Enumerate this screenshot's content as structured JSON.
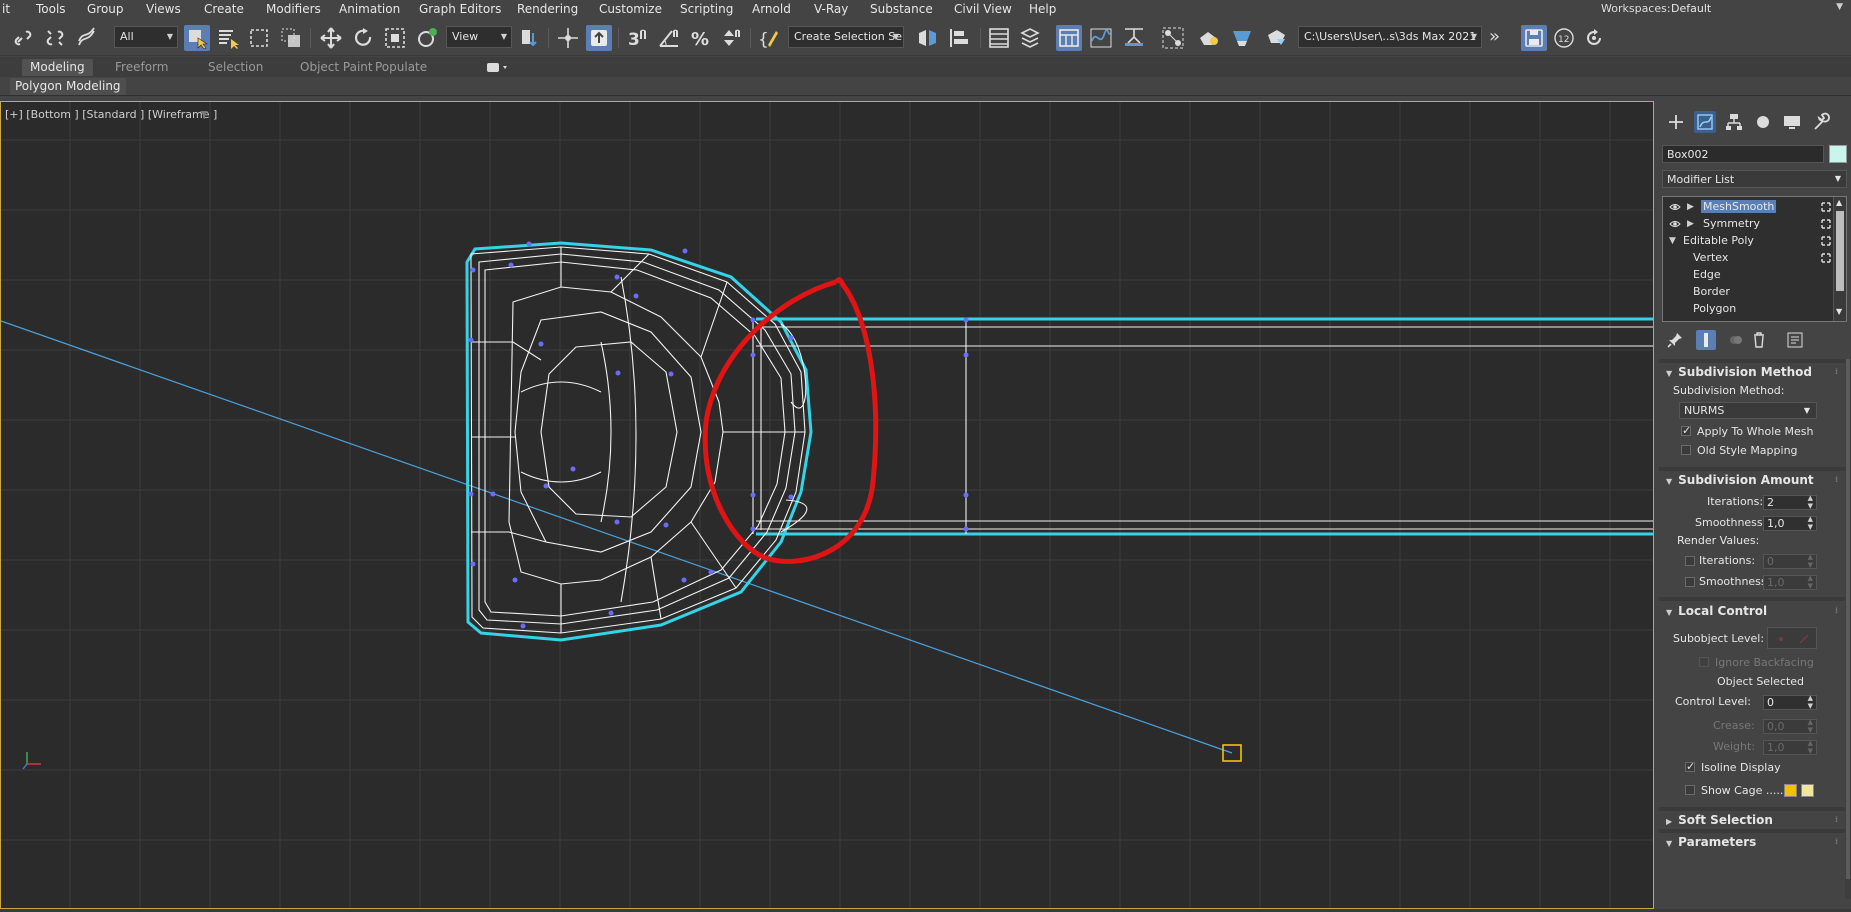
{
  "menu": {
    "items": [
      "it",
      "Tools",
      "Group",
      "Views",
      "Create",
      "Modifiers",
      "Animation",
      "Graph Editors",
      "Rendering",
      "Customize",
      "Scripting",
      "Arnold",
      "V-Ray",
      "Substance",
      "Civil View",
      "Help"
    ],
    "workspaces_label": "Workspaces:",
    "workspaces_value": "Default"
  },
  "toolbar": {
    "selection_filter": "All",
    "reference_coord": "View",
    "selection_set": "Create Selection Se",
    "project_path": "C:\\Users\\User\\..s\\3ds Max 2021",
    "badge_count": "12",
    "overflow": "»"
  },
  "ribbon": {
    "tabs": [
      "Modeling",
      "Freeform",
      "Selection",
      "Object Paint",
      "Populate"
    ],
    "active_tab": "Modeling",
    "panel_label": "Polygon Modeling"
  },
  "viewport": {
    "label": "[+] [Bottom ] [Standard ] [Wireframe ]"
  },
  "command_panel": {
    "object_name": "Box002",
    "object_color": "#c8f5ec",
    "modifier_list_label": "Modifier List",
    "stack": [
      {
        "label": "MeshSmooth",
        "selected": true
      },
      {
        "label": "Symmetry",
        "selected": false
      },
      {
        "label": "Editable Poly",
        "selected": false
      },
      {
        "label": "Vertex",
        "selected": false
      },
      {
        "label": "Edge",
        "selected": false
      },
      {
        "label": "Border",
        "selected": false
      },
      {
        "label": "Polygon",
        "selected": false
      }
    ],
    "subdivision_method": {
      "title": "Subdivision Method",
      "method_label": "Subdivision Method:",
      "method_value": "NURMS",
      "apply_whole_mesh": "Apply To Whole Mesh",
      "apply_whole_mesh_checked": true,
      "old_style_mapping": "Old Style Mapping",
      "old_style_mapping_checked": false
    },
    "subdivision_amount": {
      "title": "Subdivision Amount",
      "iterations_label": "Iterations:",
      "iterations_value": "2",
      "smoothness_label": "Smoothness:",
      "smoothness_value": "1,0",
      "render_values_label": "Render Values:",
      "render_iterations_label": "Iterations:",
      "render_iterations_value": "0",
      "render_smoothness_label": "Smoothness:",
      "render_smoothness_value": "1,0"
    },
    "local_control": {
      "title": "Local Control",
      "subobject_label": "Subobject Level:",
      "ignore_backfacing": "Ignore Backfacing",
      "object_selected": "Object Selected",
      "control_level_label": "Control Level:",
      "control_level_value": "0",
      "crease_label": "Crease:",
      "crease_value": "0,0",
      "weight_label": "Weight:",
      "weight_value": "1,0",
      "isoline_display": "Isoline Display",
      "isoline_checked": true,
      "show_cage": "Show Cage ......",
      "show_cage_checked": false,
      "cage_color_1": "#f2c200",
      "cage_color_2": "#f0e6a0"
    },
    "soft_selection": {
      "title": "Soft Selection"
    },
    "parameters": {
      "title": "Parameters"
    }
  },
  "colors": {
    "accent": "#5b7fb5",
    "viewport_bg": "#2b2b2b",
    "viewport_border": "#c9a846",
    "selection_outline": "#35d3e8",
    "annotation": "#e01414"
  }
}
